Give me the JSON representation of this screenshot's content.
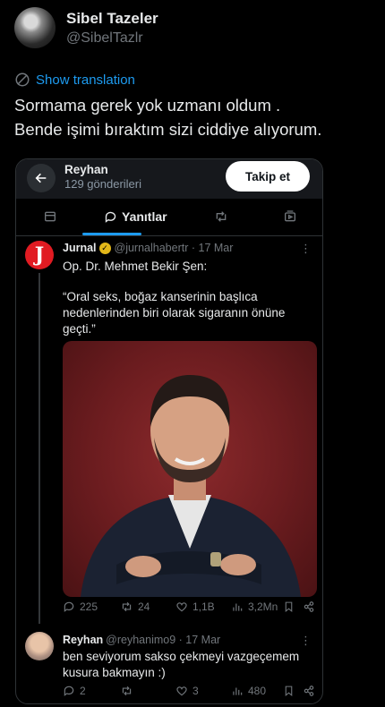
{
  "author": {
    "display_name": "Sibel Tazeler",
    "handle": "@SibelTazlr"
  },
  "translate_label": "Show translation",
  "tweet_lines": [
    "Sormama gerek yok uzmanı oldum .",
    "Bende işimi bıraktım sizi ciddiye alıyorum."
  ],
  "screenshot": {
    "profile_name": "Reyhan",
    "posts_count": "129 gönderileri",
    "follow_label": "Takip et",
    "tabs": {
      "active_label": "Yanıtlar"
    },
    "quoted": {
      "name": "Jurnal",
      "handle": "@jurnalhabertr",
      "date": "· 17 Mar",
      "logo_letter": "J",
      "line1": "Op. Dr. Mehmet Bekir Şen:",
      "line2": "“Oral seks, boğaz kanserinin başlıca nedenlerinden biri olarak sigaranın önüne geçti.”",
      "stats": {
        "replies": "225",
        "reposts": "24",
        "likes": "1,1B",
        "views": "3,2Mn"
      }
    },
    "reply": {
      "name": "Reyhan",
      "handle": "@reyhanimo9",
      "date": "· 17 Mar",
      "text": "ben seviyorum sakso çekmeyi vazgeçemem kusura bakmayın :)",
      "stats": {
        "replies": "2",
        "reposts": "",
        "likes": "3",
        "views": "480"
      }
    }
  },
  "colors": {
    "accent": "#1d9bf0",
    "background": "#000000",
    "quote_logo": "#e11b22",
    "verified_badge": "#e2b719"
  }
}
